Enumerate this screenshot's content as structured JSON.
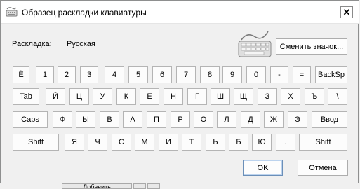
{
  "window": {
    "title": "Образец раскладки клавиатуры",
    "close_label": "✕"
  },
  "layout_info": {
    "label": "Раскладка:",
    "value": "Русская",
    "change_icon_button": "Сменить значок..."
  },
  "keys": {
    "row1": [
      "Ё",
      "1",
      "2",
      "3",
      "4",
      "5",
      "6",
      "7",
      "8",
      "9",
      "0",
      "-",
      "=",
      "BackSp"
    ],
    "row2": [
      "Tab",
      "Й",
      "Ц",
      "У",
      "К",
      "Е",
      "Н",
      "Г",
      "Ш",
      "Щ",
      "З",
      "Х",
      "Ъ",
      "\\"
    ],
    "row3": [
      "Caps",
      "Ф",
      "Ы",
      "В",
      "А",
      "П",
      "Р",
      "О",
      "Л",
      "Д",
      "Ж",
      "Э",
      "Ввод"
    ],
    "row4": [
      "Shift",
      "Я",
      "Ч",
      "С",
      "М",
      "И",
      "Т",
      "Ь",
      "Б",
      "Ю",
      ".",
      "Shift"
    ]
  },
  "buttons": {
    "ok": "OK",
    "cancel": "Отмена"
  },
  "background": {
    "fragment_label": "Добавить"
  },
  "icons": {
    "title": "keyboard-icon",
    "layout": "keyboard-icon",
    "close": "close-icon"
  }
}
